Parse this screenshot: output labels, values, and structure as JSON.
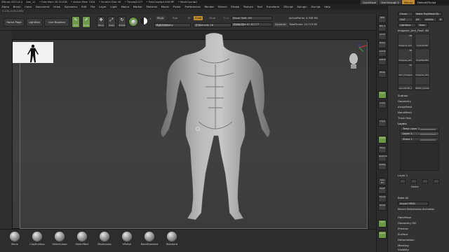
{
  "titlebar": {
    "items": [
      "ZBrush 2021.6.4",
      "Ami_11",
      "• Free Mem 20.511GB",
      "• Active Mem 7434",
      "• Scratch Disk 49",
      "• Timer▸0.077",
      "• PolyCount▸4.948 MP",
      "• MeshCount▸2"
    ]
  },
  "topright": {
    "quicksave": "QuickSave",
    "seethrough": "See-through 0",
    "menus": "Menus",
    "script": "DefaultZScript"
  },
  "menubar": {
    "items": [
      "Alpha",
      "Brush",
      "Color",
      "Document",
      "Draw",
      "Dynamics",
      "Edit",
      "File",
      "Layer",
      "Light",
      "Macro",
      "Marker",
      "Material",
      "Movie",
      "Picker",
      "Preferences",
      "Render",
      "Stencil",
      "Stroke",
      "Texture",
      "Tool",
      "Transform",
      "ZScript",
      "Zplugin",
      "Zscript",
      "Help"
    ]
  },
  "coords": "0.178,-0.09,0.893",
  "toolbar": {
    "home": "Home Page",
    "lightbox": "LightBox",
    "liveboolean": "Live Boolean",
    "edit": "Edit",
    "draw": "Draw",
    "move": "Move",
    "scale": "Scale",
    "rotate": "Rotate",
    "a_label": "A",
    "mrgb": "Mrgb",
    "rgb": "Rgb",
    "m": "M",
    "rgb_intensity": "Rgb Intensity",
    "zadd": "Zadd",
    "zsub": "Zsub",
    "zcut": "Zcut",
    "z_intensity": "Z Intensity 18",
    "focal_shift": "Focal Shift -99",
    "draw_size": "Draw Size 67.81777",
    "dynamic": "Dynamic",
    "active_points": "ActivePoints: 4.938 Mil",
    "total_points": "TotalPoints: 24.719 Mil"
  },
  "brushes": [
    {
      "label": "Move"
    },
    {
      "label": "ClayBuildup"
    },
    {
      "label": "SelectLasso"
    },
    {
      "label": "SelectRect"
    },
    {
      "label": "MaskLasso"
    },
    {
      "label": "hPolish"
    },
    {
      "label": "DamStandard"
    },
    {
      "label": "Standard"
    }
  ],
  "rstrip": [
    "BPR",
    "SPix 3",
    "Scroll",
    "Zoom",
    "Actual",
    "AAHalf",
    "Persp",
    "Floor",
    "Local",
    "L.Sym",
    "Frame",
    "Move",
    "Zoom3D",
    "Rotate",
    "Line Fill",
    "PolyF",
    "Transp",
    "Ghost",
    "Solo",
    "Xpose"
  ],
  "rpanel": {
    "top_buttons": [
      "Clone",
      "Make PolyMesh3D",
      "GoZ",
      "All",
      "Visible",
      "R",
      "Lightbox",
      "Tools"
    ],
    "tool_name": "Imogene_Ami_Final: 48",
    "tiles": [
      {
        "cap": "Imogene_Ami_Fina",
        "num": "38"
      },
      {
        "cap": "Cylinder3D",
        "num": ""
      },
      {
        "cap": "Imogene_Ami_Fina",
        "num": "38"
      },
      {
        "cap": "PolyMesh3D",
        "num": ""
      },
      {
        "cap": "Skin_Imogene",
        "num": "34"
      },
      {
        "cap": "Imogene_Ami_Fin",
        "num": ""
      },
      {
        "cap": "SimpleBrush",
        "num": ""
      },
      {
        "cap": "Ami_Volume_Fina",
        "num": ""
      },
      {
        "cap": "Cylinder3D_1",
        "num": ""
      },
      {
        "cap": "PM3D_Cylinder3",
        "num": ""
      }
    ],
    "sections": [
      "Subtool",
      "Geometry",
      "ArrayMesh",
      "NanoMesh",
      "Thick Skin",
      "Layers"
    ],
    "layers": [
      "Temp Layer 1",
      "Layer 1",
      "Stone 1"
    ],
    "layer_label": "Layer 1",
    "layer_actions": [
      "Name",
      "Bake All",
      "Import MDD",
      "Record Deformation Animation"
    ],
    "bottom_sections": [
      "FiberMesh",
      "Geometry HD",
      "Preview",
      "Surface",
      "Deformation",
      "Masking",
      "Visibility"
    ]
  }
}
